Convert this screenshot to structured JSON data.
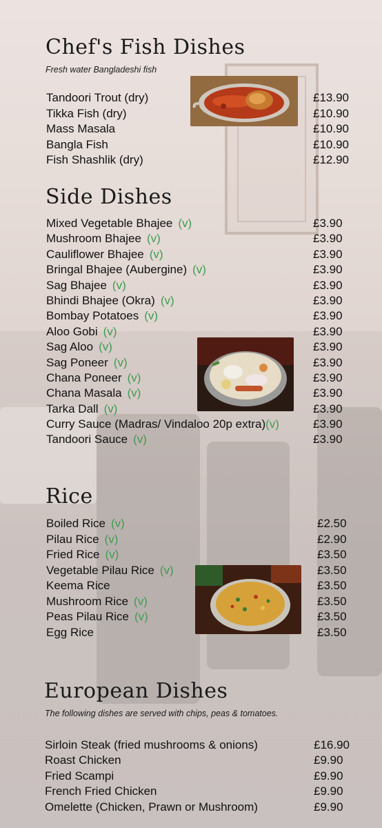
{
  "sections": {
    "fish": {
      "title": "Chef's Fish Dishes",
      "subtitle": "Fresh water Bangladeshi fish",
      "items": [
        {
          "name": "Tandoori Trout (dry)",
          "price": "£13.90"
        },
        {
          "name": "Tikka Fish (dry)",
          "price": "£10.90"
        },
        {
          "name": "Mass Masala",
          "price": "£10.90"
        },
        {
          "name": "Bangla Fish",
          "price": "£10.90"
        },
        {
          "name": "Fish Shashlik (dry)",
          "price": "£12.90"
        }
      ]
    },
    "side": {
      "title": "Side Dishes",
      "items": [
        {
          "name": "Mixed Vegetable Bhajee",
          "veg": "(v)",
          "price": "£3.90"
        },
        {
          "name": "Mushroom Bhajee",
          "veg": "(v)",
          "price": "£3.90"
        },
        {
          "name": "Cauliflower Bhajee",
          "veg": "(v)",
          "price": "£3.90"
        },
        {
          "name": "Bringal Bhajee (Aubergine)",
          "veg": "(v)",
          "price": "£3.90"
        },
        {
          "name": "Sag Bhajee",
          "veg": "(v)",
          "price": "£3.90"
        },
        {
          "name": "Bhindi Bhajee (Okra)",
          "veg": "(v)",
          "price": "£3.90"
        },
        {
          "name": "Bombay Potatoes",
          "veg": "(v)",
          "price": "£3.90"
        },
        {
          "name": "Aloo Gobi",
          "veg": "(v)",
          "price": "£3.90"
        },
        {
          "name": "Sag Aloo",
          "veg": "(v)",
          "price": "£3.90"
        },
        {
          "name": "Sag Poneer",
          "veg": "(v)",
          "price": "£3.90"
        },
        {
          "name": "Chana Poneer",
          "veg": "(v)",
          "price": "£3.90"
        },
        {
          "name": "Chana Masala",
          "veg": "(v)",
          "price": "£3.90"
        },
        {
          "name": "Tarka Dall",
          "veg": "(v)",
          "price": "£3.90"
        },
        {
          "name": "Curry Sauce (Madras/ Vindaloo 20p extra)",
          "veg": "(v)",
          "price": "£3.90"
        },
        {
          "name": "Tandoori Sauce",
          "veg": "(v)",
          "price": "£3.90"
        }
      ]
    },
    "rice": {
      "title": "Rice",
      "items": [
        {
          "name": "Boiled Rice",
          "veg": "(v)",
          "price": "£2.50"
        },
        {
          "name": "Pilau Rice",
          "veg": "(v)",
          "price": "£2.90"
        },
        {
          "name": "Fried Rice",
          "veg": "(v)",
          "price": "£3.50"
        },
        {
          "name": "Vegetable Pilau Rice",
          "veg": "(v)",
          "price": "£3.50"
        },
        {
          "name": "Keema Rice",
          "price": "£3.50"
        },
        {
          "name": "Mushroom Rice",
          "veg": "(v)",
          "price": "£3.50"
        },
        {
          "name": "Peas Pilau Rice",
          "veg": "(v)",
          "price": "£3.50"
        },
        {
          "name": "Egg Rice",
          "price": "£3.50"
        }
      ]
    },
    "european": {
      "title": "European Dishes",
      "subtitle": "The following dishes are served with chips, peas & tomatoes.",
      "items": [
        {
          "name": "Sirloin Steak (fried mushrooms & onions)",
          "price": "£16.90"
        },
        {
          "name": "Roast Chicken",
          "price": "£9.90"
        },
        {
          "name": "Fried Scampi",
          "price": "£9.90"
        },
        {
          "name": "French Fried Chicken",
          "price": "£9.90"
        },
        {
          "name": "Omelette (Chicken, Prawn or Mushroom)",
          "price": "£9.90"
        }
      ]
    }
  },
  "colors": {
    "text": "#111111",
    "vegetarian": "#3e9b52"
  }
}
